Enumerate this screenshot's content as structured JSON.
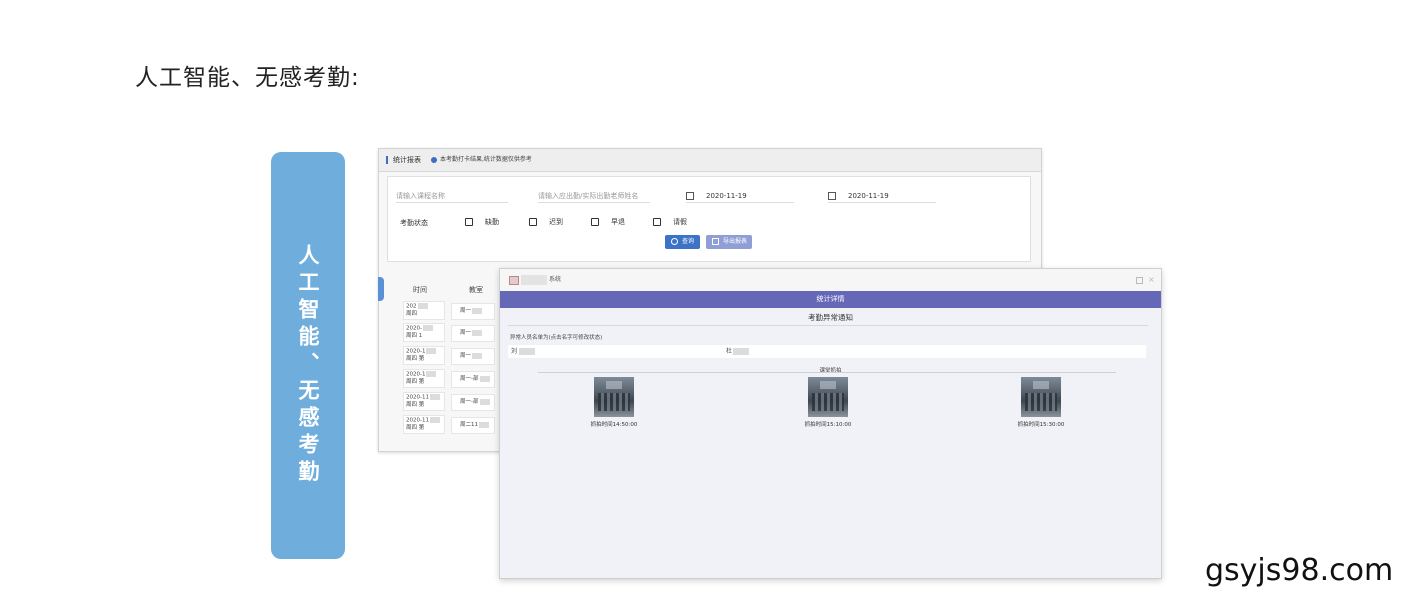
{
  "heading": "人工智能、无感考勤:",
  "side_banner": "人工智能、无感考勤",
  "back_panel": {
    "title": "统计报表",
    "note": "本考勤打卡结果,统计数据仅供参考",
    "course_placeholder": "请输入课程名称",
    "teacher_placeholder": "请输入应出勤/实际出勤老师姓名",
    "date_start": "2020-11-19",
    "date_end": "2020-11-19",
    "status_label": "考勤状态",
    "statuses": [
      "缺勤",
      "迟到",
      "早退",
      "请假"
    ],
    "query_btn": "查询",
    "export_btn": "导出报表",
    "columns": [
      "时间",
      "教室"
    ],
    "rows": [
      {
        "time": [
          "202",
          "周四"
        ],
        "room": "周一"
      },
      {
        "time": [
          "2020-",
          "周四 1"
        ],
        "room": "周一"
      },
      {
        "time": [
          "2020-1",
          "周四 第"
        ],
        "room": "周一"
      },
      {
        "time": [
          "2020-1",
          "周四 第"
        ],
        "room": "周一-部"
      },
      {
        "time": [
          "2020-11",
          "周四 第"
        ],
        "room": "周一-部"
      },
      {
        "time": [
          "2020-11",
          "周四 第"
        ],
        "room": "周二11"
      }
    ]
  },
  "dialog": {
    "window_title": "系统",
    "header": "统计详情",
    "subtitle": "考勤异常通知",
    "note": "异常人员名单为(点击名字可修改状态)",
    "names": [
      "刘",
      "杜"
    ],
    "snap_title": "课堂抓拍",
    "snapshots": [
      {
        "caption": "抓拍时间14:50:00"
      },
      {
        "caption": "抓拍时间15:10:00"
      },
      {
        "caption": "抓拍时间15:30:00"
      }
    ]
  },
  "watermark": "gsyjs98.com"
}
